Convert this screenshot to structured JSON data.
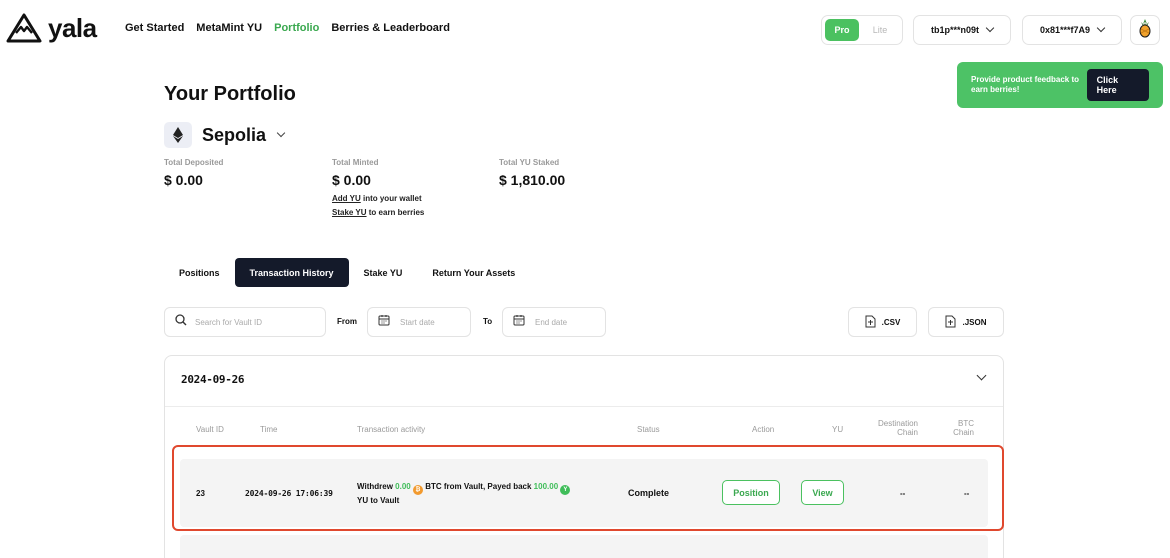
{
  "brand": {
    "name": "yala"
  },
  "nav": [
    {
      "label": "Get Started",
      "active": false
    },
    {
      "label": "MetaMint YU",
      "active": false
    },
    {
      "label": "Portfolio",
      "active": true
    },
    {
      "label": "Berries & Leaderboard",
      "active": false
    }
  ],
  "mode": {
    "pro": "Pro",
    "lite": "Lite",
    "selected": "Pro"
  },
  "accounts": {
    "btc": "tb1p***n09t",
    "evm": "0x81***f7A9"
  },
  "feedback": {
    "text": "Provide product feedback to earn berries!",
    "button": "Click Here"
  },
  "portfolio": {
    "title": "Your Portfolio",
    "network": "Sepolia",
    "stats": {
      "deposited": {
        "label": "Total Deposited",
        "value": "$ 0.00"
      },
      "minted": {
        "label": "Total Minted",
        "value": "$ 0.00",
        "add_link": "Add YU",
        "add_rest": " into your wallet",
        "stake_link": "Stake YU",
        "stake_rest": " to earn berries"
      },
      "staked": {
        "label": "Total YU Staked",
        "value": "$ 1,810.00"
      }
    }
  },
  "tabs": [
    {
      "label": "Positions",
      "active": false
    },
    {
      "label": "Transaction History",
      "active": true
    },
    {
      "label": "Stake YU",
      "active": false
    },
    {
      "label": "Return Your Assets",
      "active": false
    }
  ],
  "filters": {
    "search_placeholder": "Search for Vault ID",
    "from_label": "From",
    "to_label": "To",
    "start_placeholder": "Start date",
    "end_placeholder": "End date",
    "csv": ".CSV",
    "json": ".JSON"
  },
  "history": {
    "date": "2024-09-26",
    "columns": {
      "vault_id": "Vault ID",
      "time": "Time",
      "activity": "Transaction activity",
      "status": "Status",
      "action": "Action",
      "yu": "YU",
      "dest_chain_1": "Destination",
      "dest_chain_2": "Chain",
      "btc_chain_1": "BTC",
      "btc_chain_2": "Chain"
    },
    "rows": [
      {
        "vault_id": "23",
        "time": "2024-09-26 17:06:39",
        "activity": {
          "p1": "Withdrew ",
          "btc_amount": "0.00",
          "p2": " BTC from Vault, Payed back ",
          "yu_amount": "100.00",
          "p3": "YU to Vault"
        },
        "status": "Complete",
        "action_label": "Position",
        "yu_label": "View",
        "dest_chain": "--",
        "btc_chain": "--"
      }
    ]
  },
  "colors": {
    "accent": "#4bc160",
    "dark": "#141a2a",
    "highlight": "#e0482e",
    "btc": "#f29a2e"
  }
}
